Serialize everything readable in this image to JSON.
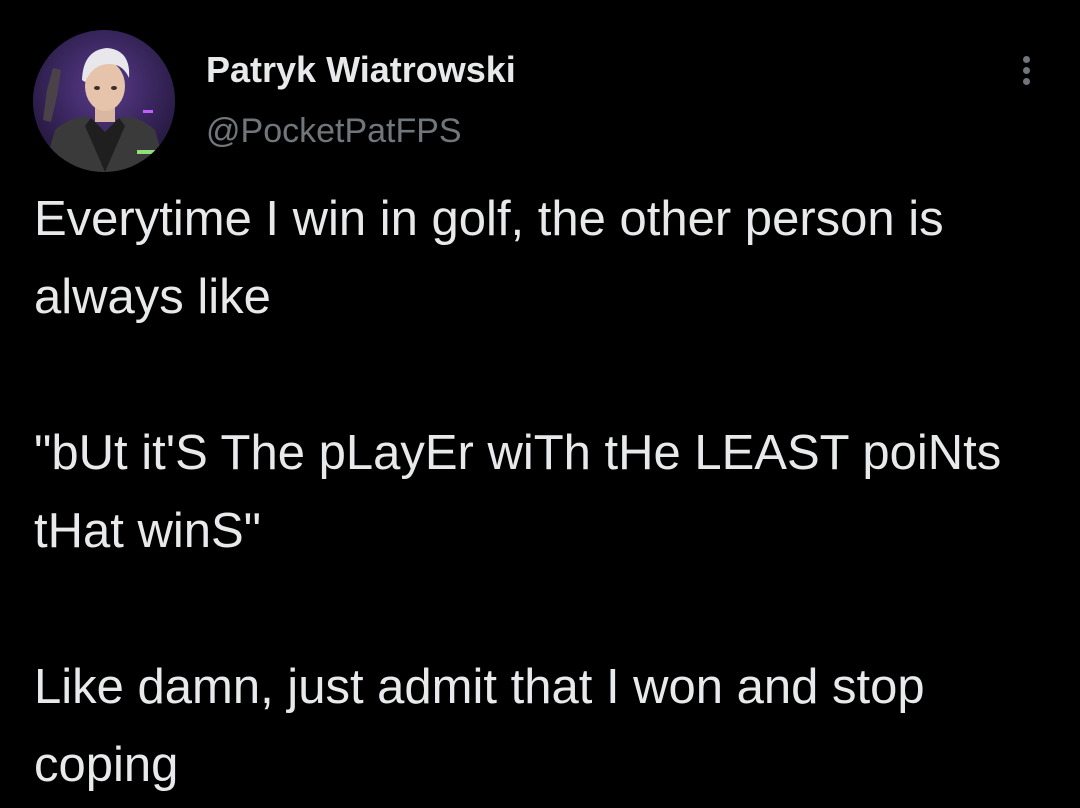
{
  "tweet": {
    "author": {
      "display_name": "Patryk Wiatrowski",
      "handle": "@PocketPatFPS",
      "avatar_icon": "profile-photo"
    },
    "menu_icon": "more-vertical-icon",
    "paragraphs": [
      "Everytime I win in golf, the other person is always like",
      "\"bUt it'S The pLayEr wiTh tHe LEAST poiNts tHat winS\"",
      "Like damn, just admit that I won and stop coping"
    ]
  },
  "colors": {
    "background": "#000000",
    "primary_text": "#e7e9ea",
    "secondary_text": "#71767b"
  }
}
